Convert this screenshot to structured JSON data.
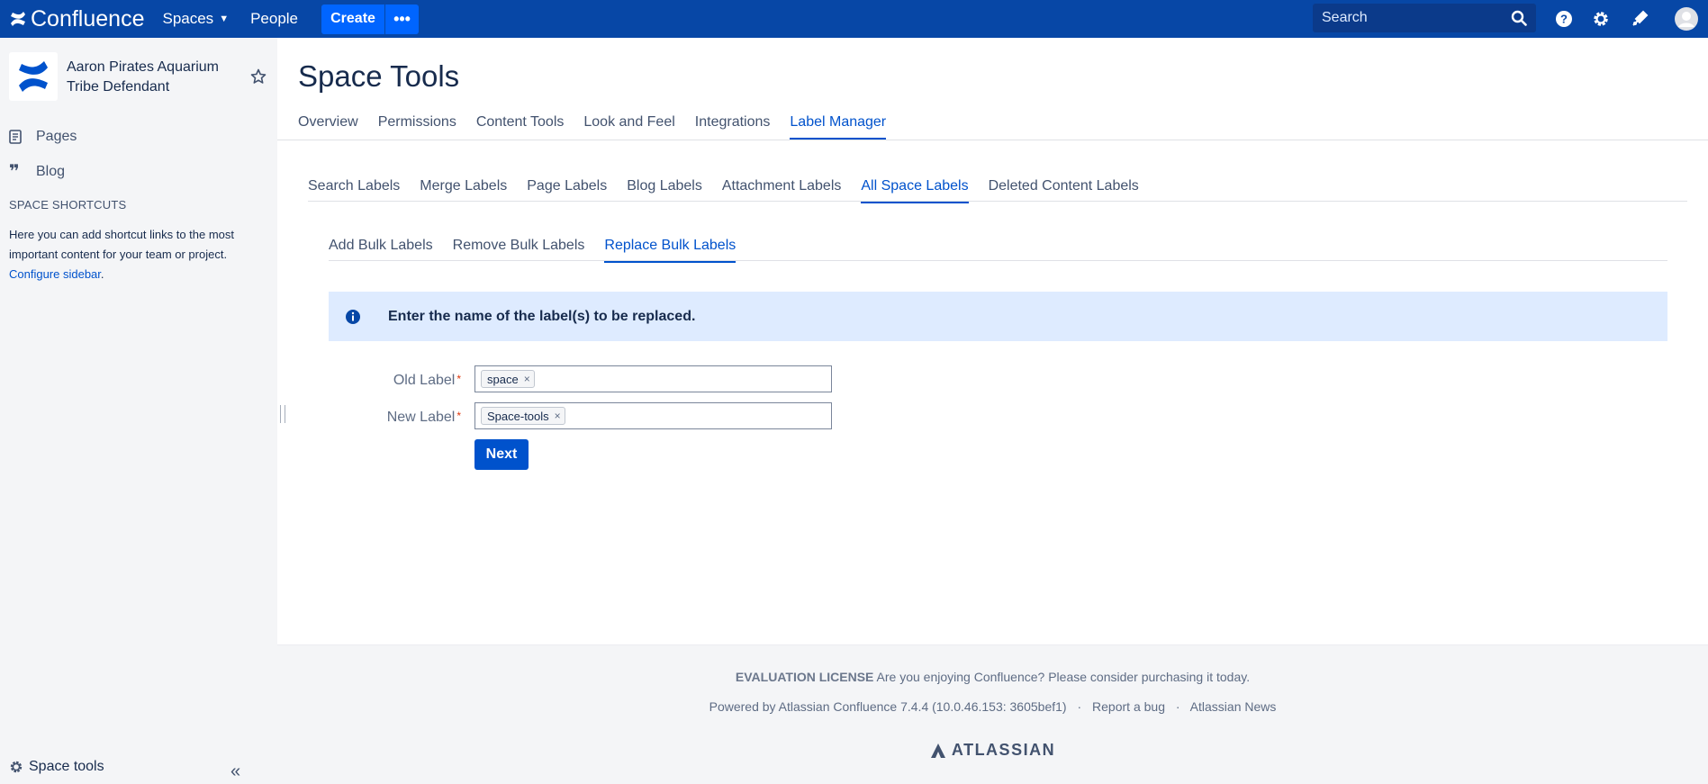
{
  "topnav": {
    "brand": "Confluence",
    "spaces_label": "Spaces",
    "people_label": "People",
    "create_label": "Create",
    "more_label": "•••",
    "search_placeholder": "Search",
    "icons": [
      "search-icon",
      "help-icon",
      "gear-icon",
      "notifications-icon",
      "avatar"
    ]
  },
  "sidebar": {
    "space_name": "Aaron Pirates Aquarium Tribe Defendant",
    "items": [
      {
        "label": "Pages",
        "icon": "pages-icon"
      },
      {
        "label": "Blog",
        "icon": "quote-icon"
      }
    ],
    "shortcuts_heading": "SPACE SHORTCUTS",
    "shortcuts_text": "Here you can add shortcut links to the most important content for your team or project.",
    "configure_link": "Configure sidebar",
    "configure_suffix": ".",
    "space_tools_label": "Space tools",
    "collapse_label": "«"
  },
  "main": {
    "title": "Space Tools",
    "tabs": [
      "Overview",
      "Permissions",
      "Content Tools",
      "Look and Feel",
      "Integrations",
      "Label Manager"
    ],
    "active_tab": "Label Manager",
    "subtabs": [
      "Search Labels",
      "Merge Labels",
      "Page Labels",
      "Blog Labels",
      "Attachment Labels",
      "All Space Labels",
      "Deleted Content Labels"
    ],
    "active_subtab": "All Space Labels",
    "bulk_tabs": [
      "Add Bulk Labels",
      "Remove Bulk Labels",
      "Replace Bulk Labels"
    ],
    "active_bulk_tab": "Replace Bulk Labels",
    "info_message": "Enter the name of the label(s) to be replaced.",
    "form": {
      "old_label": "Old Label",
      "old_value": "space",
      "new_label": "New Label",
      "new_value": "Space-tools",
      "required_mark": "*",
      "remove_mark": "×",
      "next_label": "Next"
    }
  },
  "footer": {
    "license_bold": "EVALUATION LICENSE",
    "license_text": "Are you enjoying Confluence? Please consider purchasing it today.",
    "powered_by": "Powered by Atlassian Confluence 7.4.4 (10.0.46.153: 3605bef1)",
    "report_bug": "Report a bug",
    "news": "Atlassian News",
    "separator": "·",
    "atlassian": "ATLASSIAN"
  },
  "colors": {
    "nav_bg": "#0747a6",
    "primary": "#0052cc",
    "info_bg": "#deebff",
    "sidebar_bg": "#f4f5f7"
  }
}
